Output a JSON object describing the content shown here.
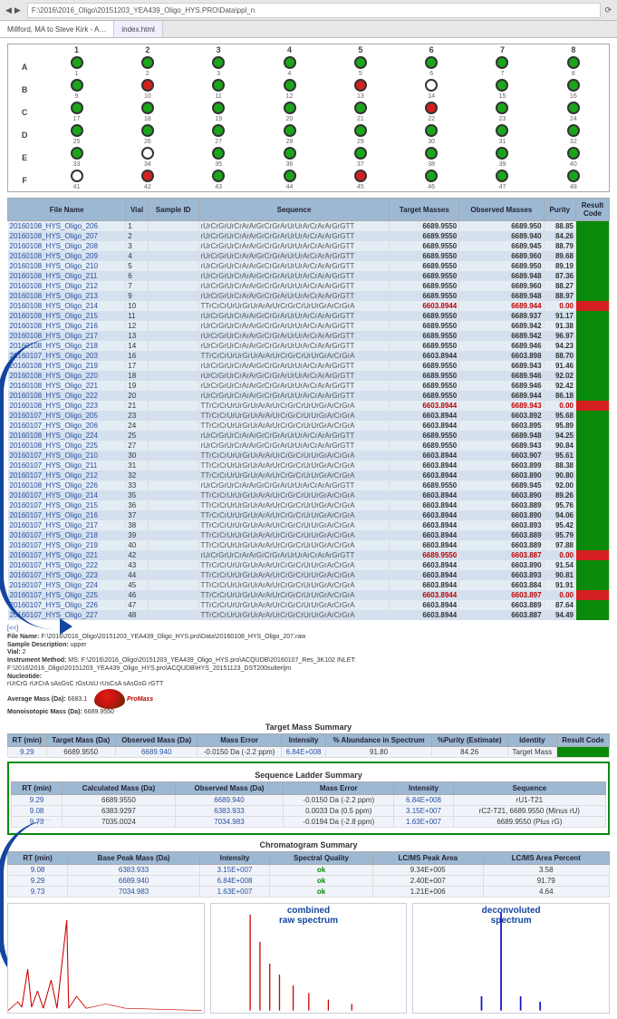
{
  "browser": {
    "url": "F:\\2016\\2016_Oligo\\20151203_YEA439_Oligo_HYS.PRO\\Data\\ppl_n",
    "tabs": [
      "Millford, MA to Steve Kirk - A…",
      "index.html"
    ]
  },
  "plate": {
    "cols": [
      1,
      2,
      3,
      4,
      5,
      6,
      7,
      8
    ],
    "rows": [
      "A",
      "B",
      "C",
      "D",
      "E",
      "F"
    ],
    "wells": [
      [
        "g",
        "g",
        "g",
        "g",
        "g",
        "g",
        "g",
        "g"
      ],
      [
        "g",
        "r",
        "g",
        "g",
        "r",
        "e",
        "g",
        "g"
      ],
      [
        "g",
        "g",
        "g",
        "g",
        "g",
        "r",
        "g",
        "g"
      ],
      [
        "g",
        "g",
        "g",
        "g",
        "g",
        "g",
        "g",
        "g"
      ],
      [
        "g",
        "e",
        "g",
        "g",
        "g",
        "g",
        "g",
        "g"
      ],
      [
        "e",
        "r",
        "g",
        "g",
        "r",
        "g",
        "g",
        "g"
      ]
    ]
  },
  "results": {
    "columns": [
      "File Name",
      "Vial",
      "Sample ID",
      "Sequence",
      "Target Masses",
      "Observed Masses",
      "Purity",
      "Result Code"
    ],
    "rows": [
      {
        "fn": "20160108_HYS_Oligo_206",
        "vial": 1,
        "seq": "rUrCrGrUrCrArArGrCrGrArUrUrArCrArArGrGTT",
        "tm": "6689.9550",
        "om": "6689.950",
        "pu": "88.85",
        "ok": true
      },
      {
        "fn": "20160108_HYS_Oligo_207",
        "vial": 2,
        "seq": "rUrCrGrUrCrArArGrCrGrArUrUrArCrArArGrGTT",
        "tm": "6689.9550",
        "om": "6689.940",
        "pu": "84.26",
        "ok": true
      },
      {
        "fn": "20160108_HYS_Oligo_208",
        "vial": 3,
        "seq": "rUrCrGrUrCrArArGrCrGrArUrUrArCrArArGrGTT",
        "tm": "6689.9550",
        "om": "6689.945",
        "pu": "88.79",
        "ok": true
      },
      {
        "fn": "20160108_HYS_Oligo_209",
        "vial": 4,
        "seq": "rUrCrGrUrCrArArGrCrGrArUrUrArCrArArGrGTT",
        "tm": "6689.9550",
        "om": "6689.960",
        "pu": "89.68",
        "ok": true
      },
      {
        "fn": "20160108_HYS_Oligo_210",
        "vial": 5,
        "seq": "rUrCrGrUrCrArArGrCrGrArUrUrArCrArArGrGTT",
        "tm": "6689.9550",
        "om": "6689.950",
        "pu": "89.19",
        "ok": true
      },
      {
        "fn": "20160108_HYS_Oligo_211",
        "vial": 6,
        "seq": "rUrCrGrUrCrArArGrCrGrArUrUrArCrArArGrGTT",
        "tm": "6689.9550",
        "om": "6689.948",
        "pu": "87.36",
        "ok": true
      },
      {
        "fn": "20160108_HYS_Oligo_212",
        "vial": 7,
        "seq": "rUrCrGrUrCrArArGrCrGrArUrUrArCrArArGrGTT",
        "tm": "6689.9550",
        "om": "6689.960",
        "pu": "88.27",
        "ok": true
      },
      {
        "fn": "20160108_HYS_Oligo_213",
        "vial": 9,
        "seq": "rUrCrGrUrCrArArGrCrGrArUrUrArCrArArGrGTT",
        "tm": "6689.9550",
        "om": "6689.948",
        "pu": "88.97",
        "ok": true
      },
      {
        "fn": "20160108_HYS_Oligo_214",
        "vial": 10,
        "seq": "TTrCrCrUrUrGrUrArArUrCrGrCrUrUrGrArCrGrA",
        "tm": "6603.8944",
        "om": "6689.944",
        "pu": "0.00",
        "ok": false
      },
      {
        "fn": "20160108_HYS_Oligo_215",
        "vial": 11,
        "seq": "rUrCrGrUrCrArArGrCrGrArUrUrArCrArArGrGTT",
        "tm": "6689.9550",
        "om": "6689.937",
        "pu": "91.17",
        "ok": true
      },
      {
        "fn": "20160108_HYS_Oligo_216",
        "vial": 12,
        "seq": "rUrCrGrUrCrArArGrCrGrArUrUrArCrArArGrGTT",
        "tm": "6689.9550",
        "om": "6689.942",
        "pu": "91.38",
        "ok": true
      },
      {
        "fn": "20160108_HYS_Oligo_217",
        "vial": 13,
        "seq": "rUrCrGrUrCrArArGrCrGrArUrUrArCrArArGrGTT",
        "tm": "6689.9550",
        "om": "6689.942",
        "pu": "96.97",
        "ok": true
      },
      {
        "fn": "20160108_HYS_Oligo_218",
        "vial": 14,
        "seq": "rUrCrGrUrCrArArGrCrGrArUrUrArCrArArGrGTT",
        "tm": "6689.9550",
        "om": "6689.946",
        "pu": "94.23",
        "ok": true
      },
      {
        "fn": "20160107_HYS_Oligo_203",
        "vial": 16,
        "seq": "TTrCrCrUrUrGrUrArArUrCrGrCrUrUrGrArCrGrA",
        "tm": "6603.8944",
        "om": "6603.898",
        "pu": "88.70",
        "ok": true
      },
      {
        "fn": "20160108_HYS_Oligo_219",
        "vial": 17,
        "seq": "rUrCrGrUrCrArArGrCrGrArUrUrArCrArArGrGTT",
        "tm": "6689.9550",
        "om": "6689.943",
        "pu": "91.46",
        "ok": true
      },
      {
        "fn": "20160108_HYS_Oligo_220",
        "vial": 18,
        "seq": "rUrCrGrUrCrArArGrCrGrArUrUrArCrArArGrGTT",
        "tm": "6689.9550",
        "om": "6689.946",
        "pu": "92.02",
        "ok": true
      },
      {
        "fn": "20160108_HYS_Oligo_221",
        "vial": 19,
        "seq": "rUrCrGrUrCrArArGrCrGrArUrUrArCrArArGrGTT",
        "tm": "6689.9550",
        "om": "6689.946",
        "pu": "92.42",
        "ok": true
      },
      {
        "fn": "20160108_HYS_Oligo_222",
        "vial": 20,
        "seq": "rUrCrGrUrCrArArGrCrGrArUrUrArCrArArGrGTT",
        "tm": "6689.9550",
        "om": "6689.944",
        "pu": "86.18",
        "ok": true
      },
      {
        "fn": "20160108_HYS_Oligo_223",
        "vial": 21,
        "seq": "TTrCrCrUrUrGrUrArArUrCrGrCrUrUrGrArCrGrA",
        "tm": "6603.8944",
        "om": "6689.943",
        "pu": "0.00",
        "ok": false
      },
      {
        "fn": "20160107_HYS_Oligo_205",
        "vial": 23,
        "seq": "TTrCrCrUrUrGrUrArArUrCrGrCrUrUrGrArCrGrA",
        "tm": "6603.8944",
        "om": "6603.892",
        "pu": "95.68",
        "ok": true
      },
      {
        "fn": "20160107_HYS_Oligo_206",
        "vial": 24,
        "seq": "TTrCrCrUrUrGrUrArArUrCrGrCrUrUrGrArCrGrA",
        "tm": "6603.8944",
        "om": "6603.895",
        "pu": "95.89",
        "ok": true
      },
      {
        "fn": "20160108_HYS_Oligo_224",
        "vial": 25,
        "seq": "rUrCrGrUrCrArArGrCrGrArUrUrArCrArArGrGTT",
        "tm": "6689.9550",
        "om": "6689.948",
        "pu": "94.25",
        "ok": true
      },
      {
        "fn": "20160108_HYS_Oligo_225",
        "vial": 27,
        "seq": "rUrCrGrUrCrArArGrCrGrArUrUrArCrArArGrGTT",
        "tm": "6689.9550",
        "om": "6689.943",
        "pu": "90.84",
        "ok": true
      },
      {
        "fn": "20160107_HYS_Oligo_210",
        "vial": 30,
        "seq": "TTrCrCrUrUrGrUrArArUrCrGrCrUrUrGrArCrGrA",
        "tm": "6603.8944",
        "om": "6603.907",
        "pu": "95.61",
        "ok": true
      },
      {
        "fn": "20160107_HYS_Oligo_211",
        "vial": 31,
        "seq": "TTrCrCrUrUrGrUrArArUrCrGrCrUrUrGrArCrGrA",
        "tm": "6603.8944",
        "om": "6603.899",
        "pu": "88.38",
        "ok": true
      },
      {
        "fn": "20160107_HYS_Oligo_212",
        "vial": 32,
        "seq": "TTrCrCrUrUrGrUrArArUrCrGrCrUrUrGrArCrGrA",
        "tm": "6603.8944",
        "om": "6603.890",
        "pu": "90.80",
        "ok": true
      },
      {
        "fn": "20160108_HYS_Oligo_226",
        "vial": 33,
        "seq": "rUrCrGrUrCrArArGrCrGrArUrUrArCrArArGrGTT",
        "tm": "6689.9550",
        "om": "6689.945",
        "pu": "92.00",
        "ok": true
      },
      {
        "fn": "20160107_HYS_Oligo_214",
        "vial": 35,
        "seq": "TTrCrCrUrUrGrUrArArUrCrGrCrUrUrGrArCrGrA",
        "tm": "6603.8944",
        "om": "6603.890",
        "pu": "89.26",
        "ok": true
      },
      {
        "fn": "20160107_HYS_Oligo_215",
        "vial": 36,
        "seq": "TTrCrCrUrUrGrUrArArUrCrGrCrUrUrGrArCrGrA",
        "tm": "6603.8944",
        "om": "6603.889",
        "pu": "95.76",
        "ok": true
      },
      {
        "fn": "20160107_HYS_Oligo_216",
        "vial": 37,
        "seq": "TTrCrCrUrUrGrUrArArUrCrGrCrUrUrGrArCrGrA",
        "tm": "6603.8944",
        "om": "6603.890",
        "pu": "94.06",
        "ok": true
      },
      {
        "fn": "20160107_HYS_Oligo_217",
        "vial": 38,
        "seq": "TTrCrCrUrUrGrUrArArUrCrGrCrUrUrGrArCrGrA",
        "tm": "6603.8944",
        "om": "6603.893",
        "pu": "95.42",
        "ok": true
      },
      {
        "fn": "20160107_HYS_Oligo_218",
        "vial": 39,
        "seq": "TTrCrCrUrUrGrUrArArUrCrGrCrUrUrGrArCrGrA",
        "tm": "6603.8944",
        "om": "6603.889",
        "pu": "95.79",
        "ok": true
      },
      {
        "fn": "20160107_HYS_Oligo_219",
        "vial": 40,
        "seq": "TTrCrCrUrUrGrUrArArUrCrGrCrUrUrGrArCrGrA",
        "tm": "6603.8944",
        "om": "6603.889",
        "pu": "97.88",
        "ok": true
      },
      {
        "fn": "20160107_HYS_Oligo_221",
        "vial": 42,
        "seq": "rUrCrGrUrCrArArGrCrGrArUrUrArCrArArGrGTT",
        "tm": "6689.9550",
        "om": "6603.887",
        "pu": "0.00",
        "ok": false
      },
      {
        "fn": "20160107_HYS_Oligo_222",
        "vial": 43,
        "seq": "TTrCrCrUrUrGrUrArArUrCrGrCrUrUrGrArCrGrA",
        "tm": "6603.8944",
        "om": "6603.890",
        "pu": "91.54",
        "ok": true
      },
      {
        "fn": "20160107_HYS_Oligo_223",
        "vial": 44,
        "seq": "TTrCrCrUrUrGrUrArArUrCrGrCrUrUrGrArCrGrA",
        "tm": "6603.8944",
        "om": "6603.893",
        "pu": "90.81",
        "ok": true
      },
      {
        "fn": "20160107_HYS_Oligo_224",
        "vial": 45,
        "seq": "TTrCrCrUrUrGrUrArArUrCrGrCrUrUrGrArCrGrA",
        "tm": "6603.8944",
        "om": "6603.884",
        "pu": "91.91",
        "ok": true
      },
      {
        "fn": "20160107_HYS_Oligo_225",
        "vial": 46,
        "seq": "TTrCrCrUrUrGrUrArArUrCrGrCrUrUrGrArCrGrA",
        "tm": "6603.8944",
        "om": "6603.897",
        "pu": "0.00",
        "ok": false
      },
      {
        "fn": "20160107_HYS_Oligo_226",
        "vial": 47,
        "seq": "TTrCrCrUrUrGrUrArArUrCrGrCrUrUrGrArCrGrA",
        "tm": "6603.8944",
        "om": "6603.889",
        "pu": "87.64",
        "ok": true
      },
      {
        "fn": "20160107_HYS_Oligo_227",
        "vial": 48,
        "seq": "TTrCrCrUrUrGrUrArArUrCrGrCrUrUrGrArCrGrA",
        "tm": "6603.8944",
        "om": "6603.887",
        "pu": "94.49",
        "ok": true
      }
    ]
  },
  "meta": {
    "back": "[<<]",
    "file_name_label": "File Name:",
    "file_name": "F:\\2016\\2016_Oligo\\20151203_YEA439_Oligo_HYS.pro\\Data\\20160108_HYS_Oligo_207.raw",
    "sample_desc_label": "Sample Description:",
    "sample_desc": "upper",
    "vial_label": "Vial:",
    "vial": "2",
    "instr_label": "Instrument Method:",
    "instr": "MS: F:\\2016\\2016_Oligo\\20151203_YEA439_Oligo_HYS.pro\\ACQUDB\\20160107_Res_3K102 INLET: F:\\2016\\2016_Oligo\\20151203_YEA439_Oligo_HYS.pro\\ACQUDB\\HYS_20151123_DST200sulterljm",
    "nucl_label": "Nucleotide:",
    "nucl": "rUrCrG rUrCrA sAsGsC rGsUsU rUsCsA sAsGsG rGTT",
    "avg_label": "Average Mass (Da):",
    "avg": "6683.1",
    "mono_label": "Monoisotopic Mass (Da):",
    "mono": "6689.9550",
    "logo_text": "ProMass"
  },
  "target_summary": {
    "title": "Target Mass Summary",
    "columns": [
      "RT (min)",
      "Target Mass (Da)",
      "Observed Mass (Da)",
      "Mass Error",
      "Intensity",
      "% Abundance in Spectrum",
      "%Purity (Estimate)",
      "Identity",
      "Result Code"
    ],
    "row": {
      "rt": "9.29",
      "tm": "6689.9550",
      "om": "6689.940",
      "err": "-0.0150 Da (-2.2 ppm)",
      "int": "6.84E+008",
      "abund": "91.80",
      "pur": "84.26",
      "id": "Target Mass"
    }
  },
  "ladder": {
    "title": "Sequence Ladder Summary",
    "columns": [
      "RT (min)",
      "Calculated Mass (Da)",
      "Observed Mass (Da)",
      "Mass Error",
      "Intensity",
      "Sequence"
    ],
    "rows": [
      {
        "rt": "9.29",
        "cm": "6689.9550",
        "om": "6689.940",
        "err": "-0.0150 Da (-2.2 ppm)",
        "int": "6.84E+008",
        "seq": "rU1-T21"
      },
      {
        "rt": "9.08",
        "cm": "6383.9297",
        "om": "6383.933",
        "err": "0.0033 Da (0.5 ppm)",
        "int": "3.15E+007",
        "seq": "rC2-T21, 6689.9550 (Minus rU)"
      },
      {
        "rt": "9.73",
        "cm": "7035.0024",
        "om": "7034.983",
        "err": "-0.0194 Da (-2.8 ppm)",
        "int": "1.63E+007",
        "seq": "6689.9550 (Plus rG)"
      }
    ]
  },
  "chrom": {
    "title": "Chromatogram Summary",
    "columns": [
      "RT (min)",
      "Base Peak Mass (Da)",
      "Intensity",
      "Spectral Quality",
      "LC/MS Peak Area",
      "LC/MS Area Percent"
    ],
    "rows": [
      {
        "rt": "9.08",
        "bpm": "6383.933",
        "int": "3.15E+007",
        "sq": "ok",
        "area": "9.34E+005",
        "pct": "3.58"
      },
      {
        "rt": "9.29",
        "bpm": "6689.940",
        "int": "6.84E+008",
        "sq": "ok",
        "area": "2.40E+007",
        "pct": "91.79"
      },
      {
        "rt": "9.73",
        "bpm": "7034.983",
        "int": "1.63E+007",
        "sq": "ok",
        "area": "1.21E+006",
        "pct": "4.64"
      }
    ]
  },
  "spectra": {
    "raw_title": "combined\nraw spectrum",
    "decon_title": "deconvoluted\nspectrum"
  }
}
